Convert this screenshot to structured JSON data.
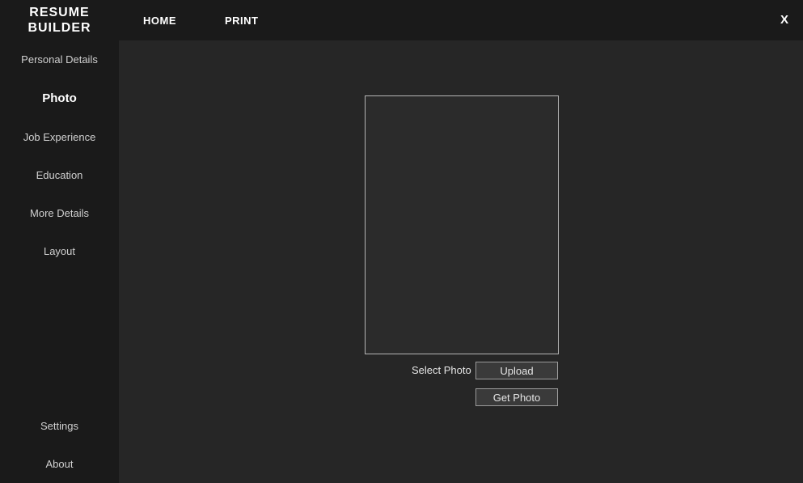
{
  "app": {
    "title_line1": "RESUME",
    "title_line2": "BUILDER"
  },
  "nav": {
    "home": "HOME",
    "print": "PRINT",
    "close": "X"
  },
  "sidebar": {
    "items": [
      {
        "label": "Personal Details",
        "active": false
      },
      {
        "label": "Photo",
        "active": true
      },
      {
        "label": "Job Experience",
        "active": false
      },
      {
        "label": "Education",
        "active": false
      },
      {
        "label": "More Details",
        "active": false
      },
      {
        "label": "Layout",
        "active": false
      }
    ],
    "bottom": [
      {
        "label": "Settings"
      },
      {
        "label": "About"
      }
    ]
  },
  "photo": {
    "select_label": "Select Photo",
    "upload_label": "Upload",
    "get_photo_label": "Get Photo"
  }
}
